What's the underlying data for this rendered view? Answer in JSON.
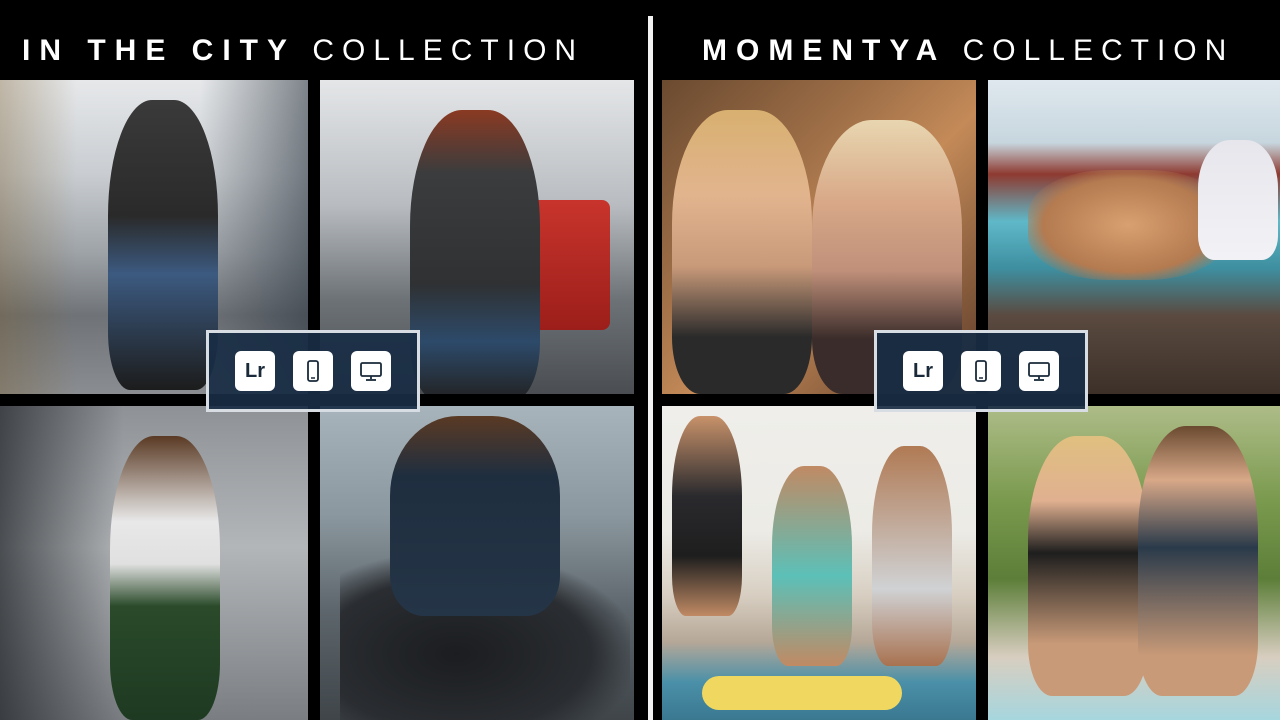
{
  "left": {
    "title_bold": "IN THE CITY",
    "title_thin": "COLLECTION",
    "photos": [
      "street-walk-photo",
      "tram-station-photo",
      "bridge-pose-photo",
      "motorcycle-photo"
    ]
  },
  "right": {
    "title_bold": "MOMENTYA",
    "title_thin": "COLLECTION",
    "photos": [
      "selfie-friends-photo",
      "pool-party-photo",
      "jumping-friends-photo",
      "couple-poolside-photo"
    ]
  },
  "badges": {
    "lr_label": "Lr",
    "icons": [
      "lightroom-icon",
      "mobile-icon",
      "desktop-icon"
    ]
  },
  "colors": {
    "background": "#000000",
    "badge_bar": "#182c44",
    "badge_border": "#d8dde3",
    "title_text": "#ffffff"
  }
}
